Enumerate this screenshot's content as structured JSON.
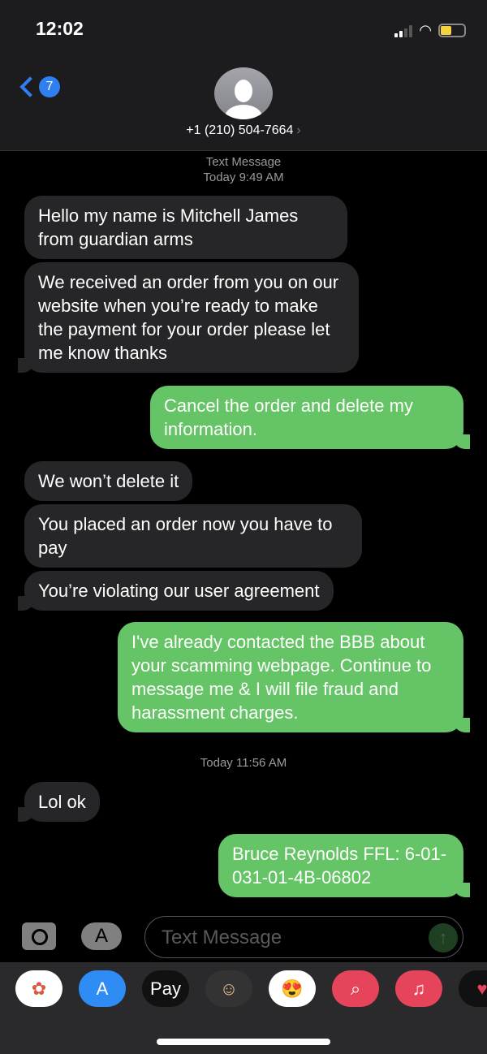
{
  "status_bar": {
    "time": "12:02",
    "signal_bars": 2,
    "battery_color": "#f5d33f"
  },
  "header": {
    "back_badge": "7",
    "contact": "+1 (210) 504-7664",
    "chevron": "›"
  },
  "thread": {
    "meta1_type": "Text Message",
    "meta1_time": "Today 9:49 AM",
    "meta2_time": "Today 11:56 AM",
    "messages": [
      {
        "dir": "in",
        "text": "Hello my name is Mitchell James from guardian arms"
      },
      {
        "dir": "in",
        "text": "We received an order from you on our website when you’re ready to make the payment for your order please let me know thanks"
      },
      {
        "dir": "out",
        "text": "Cancel the order and delete my information."
      },
      {
        "dir": "in",
        "text": "We won’t delete it"
      },
      {
        "dir": "in",
        "text": "You placed an order now you have to pay"
      },
      {
        "dir": "in",
        "text": "You’re violating our user agreement"
      },
      {
        "dir": "out",
        "text": "I've already contacted the BBB about your scamming webpage. Continue to message me & I will file fraud and harassment charges."
      },
      {
        "dir": "in",
        "text": "Lol ok"
      },
      {
        "dir": "out",
        "text": "Bruce Reynolds FFL: 6-01-031-01-4B-06802"
      }
    ]
  },
  "composer": {
    "placeholder": "Text Message",
    "send_icon": "↑",
    "apps_icon": "A"
  },
  "drawer": {
    "apps": [
      {
        "name": "photos",
        "glyph": "✿",
        "bg": "#ffffff",
        "fg": "#e0553f"
      },
      {
        "name": "app-store",
        "glyph": "A",
        "bg": "#2f8cf5",
        "fg": "#ffffff"
      },
      {
        "name": "apple-pay",
        "glyph": "Pay",
        "bg": "#111111",
        "fg": "#ffffff"
      },
      {
        "name": "memoji",
        "glyph": "☺",
        "bg": "#333333",
        "fg": "#f0c38e"
      },
      {
        "name": "memoji-stickers",
        "glyph": "😍",
        "bg": "#ffffff",
        "fg": "#e33"
      },
      {
        "name": "web-search",
        "glyph": "⌕",
        "bg": "#e6445a",
        "fg": "#ffffff"
      },
      {
        "name": "music",
        "glyph": "♫",
        "bg": "#e6445a",
        "fg": "#ffffff"
      },
      {
        "name": "digital-touch",
        "glyph": "♥",
        "bg": "#111111",
        "fg": "#e6445a"
      }
    ]
  }
}
